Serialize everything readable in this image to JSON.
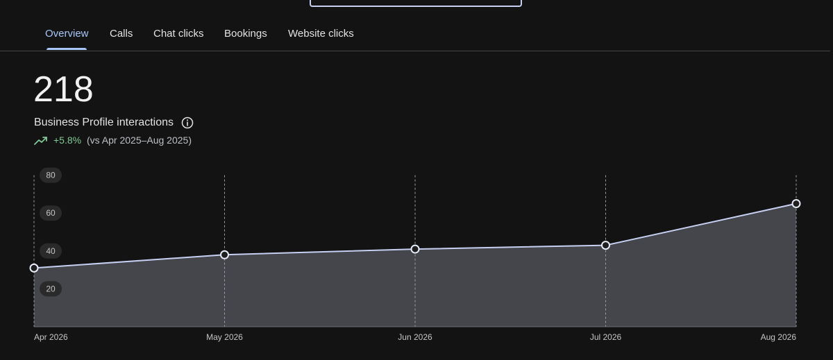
{
  "tabs": [
    {
      "label": "Overview",
      "active": true
    },
    {
      "label": "Calls",
      "active": false
    },
    {
      "label": "Chat clicks",
      "active": false
    },
    {
      "label": "Bookings",
      "active": false
    },
    {
      "label": "Website clicks",
      "active": false
    }
  ],
  "summary": {
    "total": "218",
    "label": "Business Profile interactions",
    "info_icon": "info-icon",
    "trend_icon": "trending-up-icon",
    "change": "+5.8%",
    "comparison": "(vs Apr 2025–Aug 2025)"
  },
  "colors": {
    "background": "#131313",
    "accent": "#a8c7fa",
    "positive": "#81c995",
    "line": "#c7d0f2",
    "area": "#4a4d52"
  },
  "chart_data": {
    "type": "area",
    "categories": [
      "Apr 2026",
      "May 2026",
      "Jun 2026",
      "Jul 2026",
      "Aug 2026"
    ],
    "values": [
      31,
      38,
      41,
      43,
      65
    ],
    "yticks": [
      20,
      40,
      60,
      80
    ],
    "ylim": [
      0,
      80
    ],
    "grid": "vertical dashed",
    "markers": true
  }
}
